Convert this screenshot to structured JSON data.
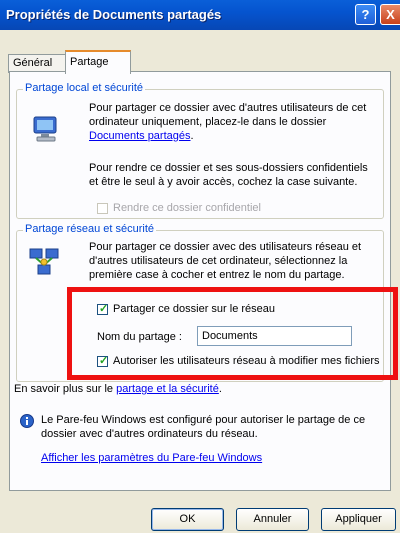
{
  "window": {
    "title": "Propriétés de Documents partagés",
    "help_label": "?",
    "close_label": "X"
  },
  "tabs": [
    {
      "label": "Général"
    },
    {
      "label": "Partage"
    }
  ],
  "local": {
    "legend": "Partage local et sécurité",
    "text1": "Pour partager ce dossier avec d'autres utilisateurs de cet ordinateur uniquement, placez-le dans le dossier",
    "link": "Documents partagés",
    "link_suffix": ".",
    "text2": "Pour rendre ce dossier et ses sous-dossiers confidentiels et être le seul à y avoir accès, cochez la case suivante.",
    "checkbox_label": "Rendre ce dossier confidentiel"
  },
  "network": {
    "legend": "Partage réseau et sécurité",
    "text": "Pour partager ce dossier avec des utilisateurs réseau et d'autres utilisateurs de cet ordinateur, sélectionnez la première case à cocher et entrez le nom du partage.",
    "share_checkbox_label": "Partager ce dossier sur le réseau",
    "share_name_label": "Nom du partage :",
    "share_name_value": "Documents",
    "allow_checkbox_label": "Autoriser les utilisateurs réseau à modifier mes fichiers"
  },
  "learn_more": {
    "prefix": "En savoir plus sur le ",
    "link": "partage et la sécurité",
    "suffix": "."
  },
  "firewall": {
    "text": "Le Pare-feu Windows est configuré pour autoriser le partage de ce dossier avec d'autres ordinateurs du réseau.",
    "link": "Afficher les paramètres du Pare-feu Windows"
  },
  "buttons": {
    "ok": "OK",
    "cancel": "Annuler",
    "apply": "Appliquer"
  }
}
